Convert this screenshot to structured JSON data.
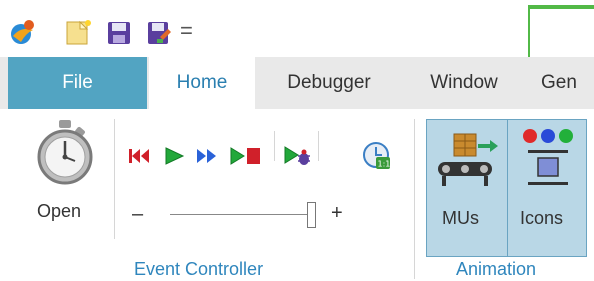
{
  "quick_access": {
    "icons": [
      "app-logo-icon",
      "new-file-icon",
      "save-icon",
      "save-as-icon",
      "customize-arrow-icon"
    ],
    "dropdown_glyph": "="
  },
  "tabs": [
    {
      "label": "File"
    },
    {
      "label": "Home"
    },
    {
      "label": "Debugger"
    },
    {
      "label": "Window"
    },
    {
      "label": "Gen"
    }
  ],
  "event_controller": {
    "open_label": "Open",
    "slider_minus": "–",
    "slider_plus": "+",
    "slider_level": 1.0,
    "group_label": "Event Controller",
    "playback_icons": [
      "reset-icon",
      "play-icon",
      "fast-forward-icon",
      "step-icon",
      "debug-icon",
      "real-time-icon"
    ]
  },
  "animation": {
    "mus_label": "MUs",
    "icons_label": "Icons",
    "group_label": "Animation"
  },
  "colors": {
    "file_tab": "#52a4c2",
    "home_tab_text": "#2a7fb0",
    "group_label": "#2f86bd",
    "selected_button": "#b9d7e6",
    "accent_green": "#52b947"
  }
}
